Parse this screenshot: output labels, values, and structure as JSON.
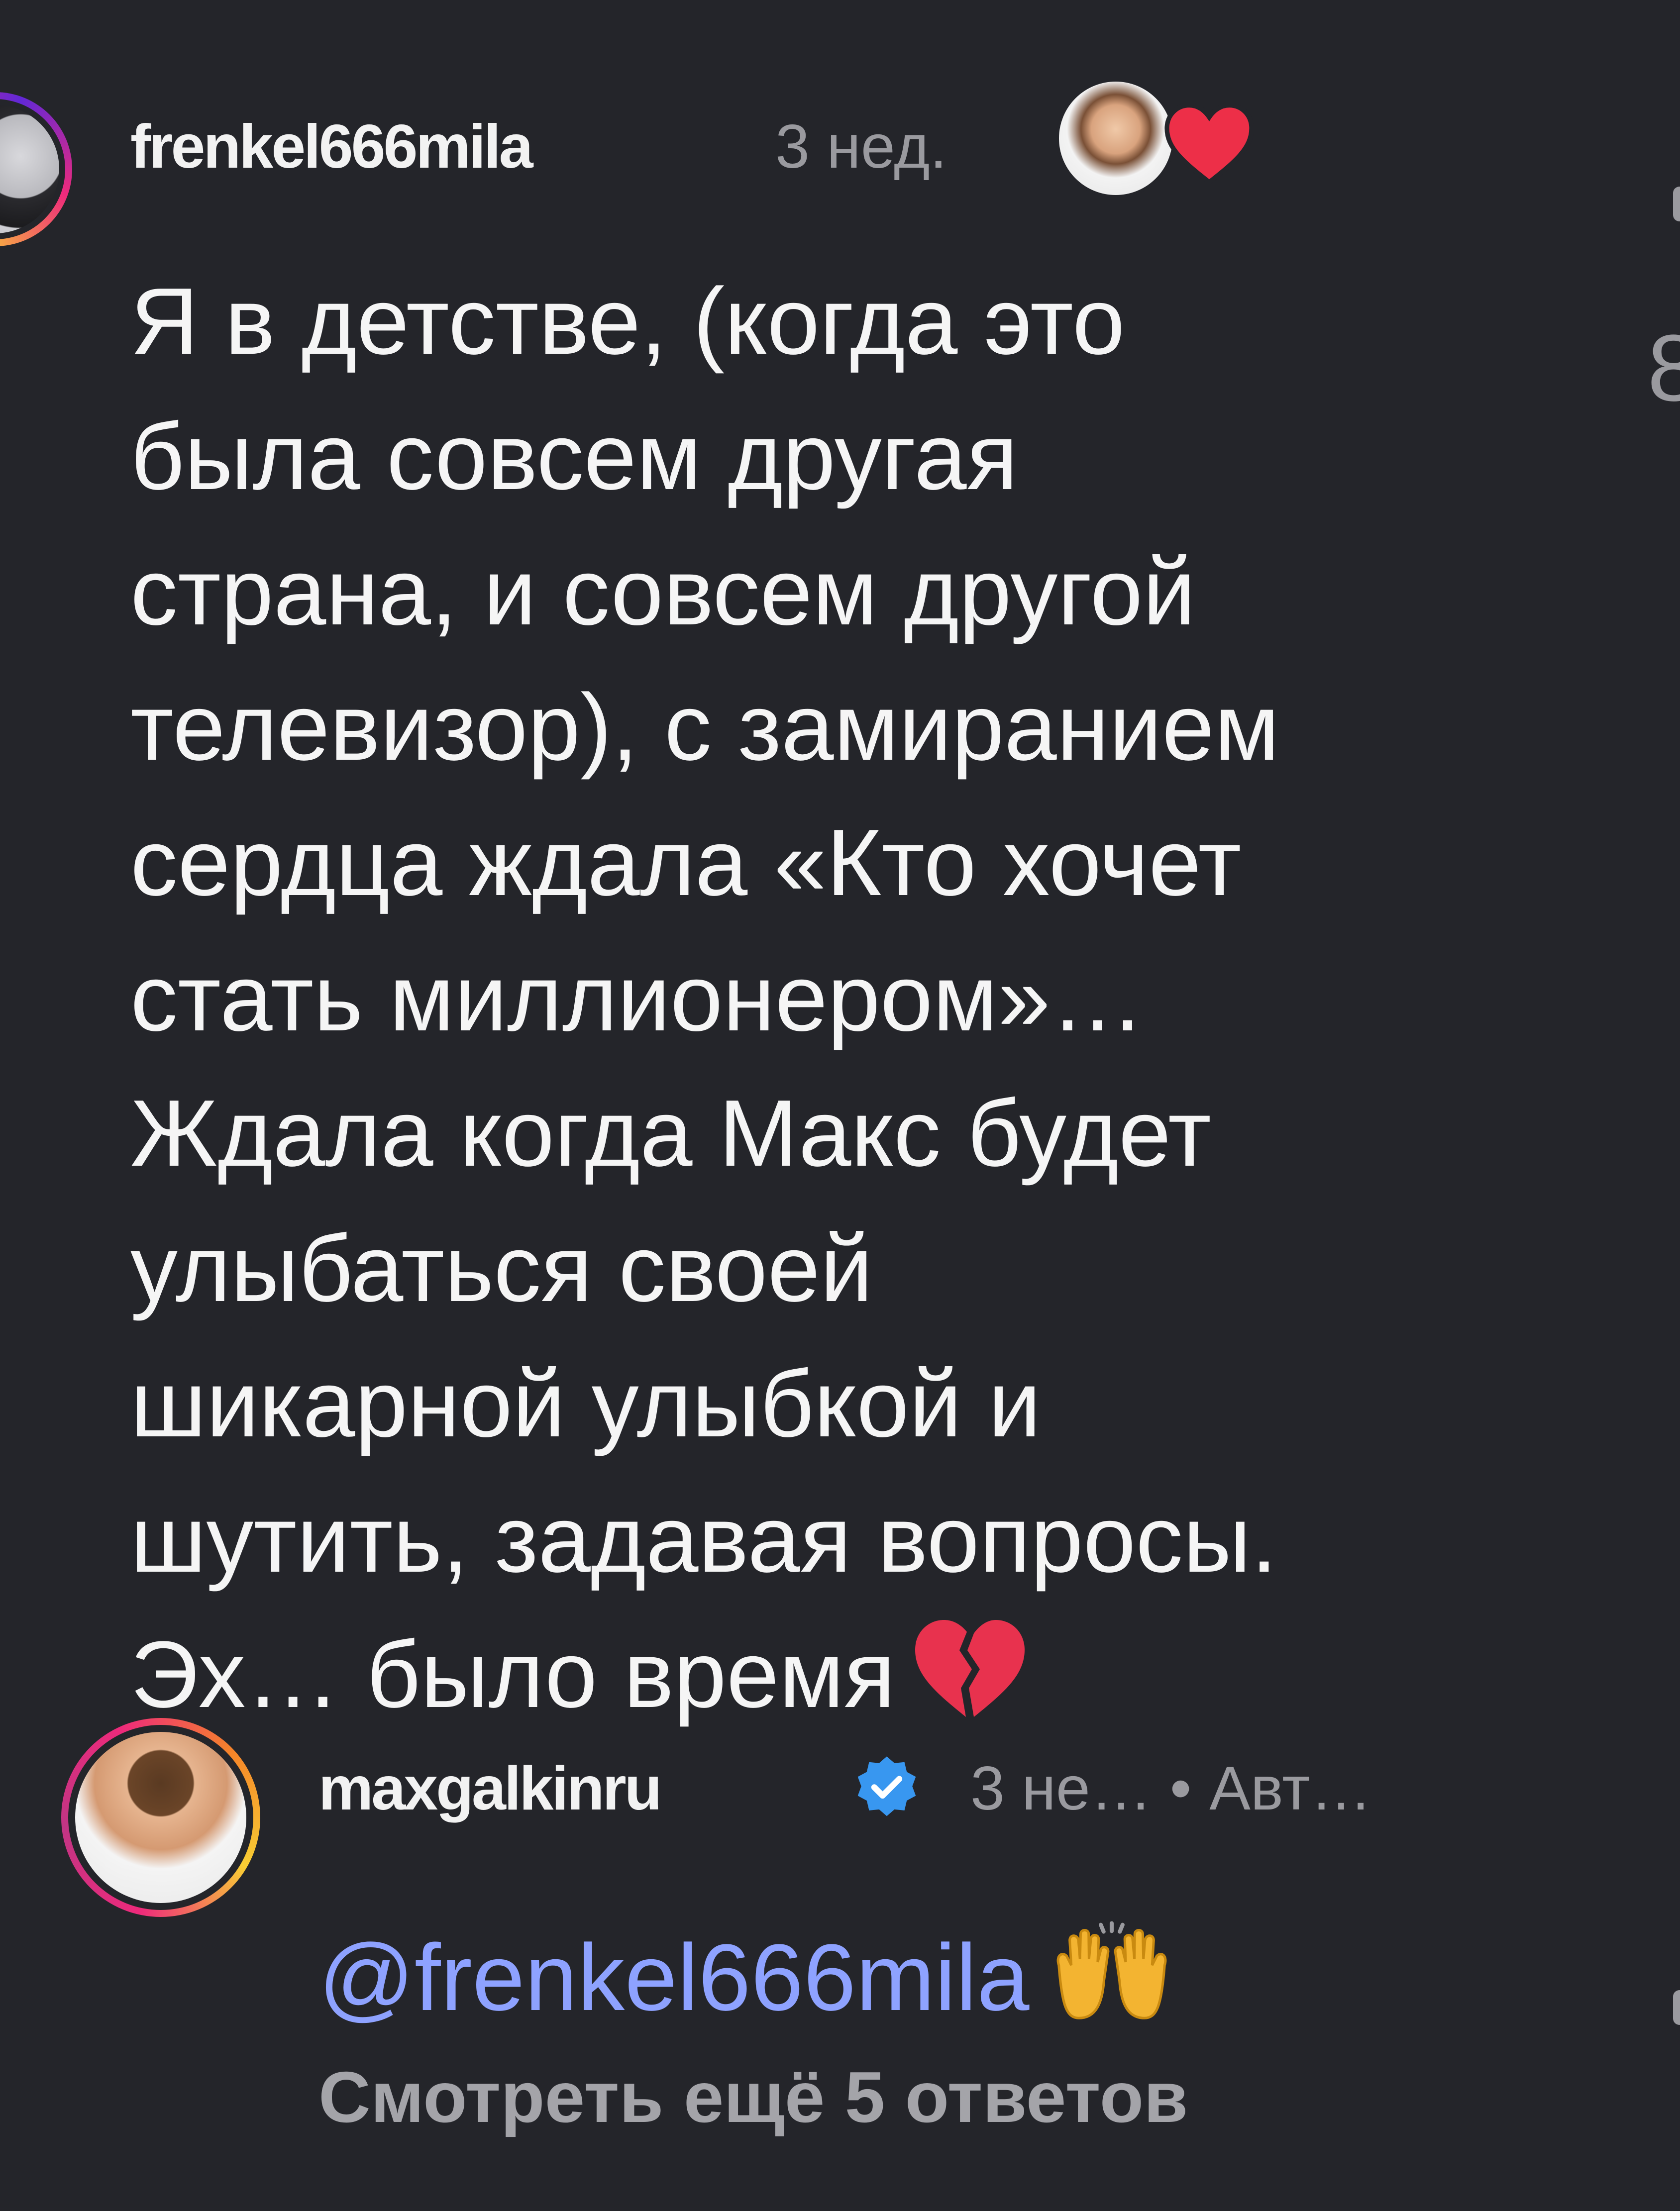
{
  "comment": {
    "username": "frenkel666mila",
    "time": "3 нед.",
    "lines": [
      "Я в детстве, (когда это",
      "была совсем другая",
      "страна, и совсем другой",
      "телевизор), с замиранием",
      "сердца ждала «Кто хочет",
      "стать миллионером»…",
      "Ждала когда Макс будет",
      "улыбаться своей",
      "шикарной улыбкой и",
      "шутить, задавая вопросы.",
      "Эх… было время"
    ],
    "emoji": "broken-heart-icon",
    "liked_by_author_icon": "heart-icon"
  },
  "edge_glimpse": {
    "char": "8"
  },
  "reply": {
    "username": "maxgalkinru",
    "verified_icon": "verified-badge-icon",
    "time": "3 не…",
    "separator": "•",
    "author_label": "Авт…",
    "mention": "@frenkel666mila",
    "emoji": "raised-hands-icon"
  },
  "view_more_replies": "Смотреть ещё 5 ответов",
  "colors": {
    "background": "#24252a",
    "text": "#f5f5f5",
    "muted": "#9a9a9f",
    "mention": "#8ea2ff",
    "verified": "#3897f0",
    "heart": "#ed2f48"
  }
}
